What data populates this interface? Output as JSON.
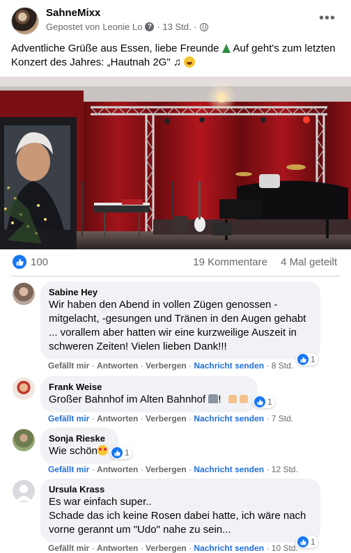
{
  "post": {
    "page_name": "SahneMixx",
    "meta_prefix": "Gepostet von",
    "author": "Leonie Lo",
    "time": "· 13 Std. ·",
    "text_line1": "Adventliche Grüße aus Essen, liebe Freunde",
    "text_line1b": "Auf geht's zum letzten",
    "text_line2": "Konzert des Jahres: „Hautnah 2G\"",
    "icons": [
      "help-icon",
      "globe-icon",
      "more-icon",
      "christmas-tree-emoji",
      "music-note-emoji",
      "grinning-face-emoji"
    ]
  },
  "stats": {
    "likes": "100",
    "comments": "19 Kommentare",
    "shares": "4 Mal geteilt"
  },
  "comment_actions": {
    "like": "Gefällt mir",
    "reply": "Antworten",
    "hide": "Verbergen",
    "message": "Nachricht senden"
  },
  "comments": [
    {
      "name": "Sabine Hey",
      "lines": [
        "Wir haben den Abend in vollen Zügen genossen -",
        "mitgelacht, -gesungen und Tränen in den Augen gehabt",
        "... vorallem aber hatten wir eine kurzweilige Auszeit in",
        "schweren Zeiten! Vielen lieben Dank!!!"
      ],
      "time": "8 Std.",
      "likes": "1"
    },
    {
      "name": "Frank Weise",
      "lines": [
        "Großer Bahnhof im Alten Bahnhof"
      ],
      "suffix": "!",
      "time": "7 Std.",
      "likes": "1"
    },
    {
      "name": "Sonja Rieske",
      "lines": [
        "Wie schön"
      ],
      "time": "12 Std.",
      "likes": "1"
    },
    {
      "name": "Ursula Krass",
      "lines": [
        "Es war einfach super..",
        "Schade das ich keine Rosen dabei hatte, ich wäre nach",
        "vorne gerannt um \"Udo\" nahe zu sein..."
      ],
      "time": "10 Std.",
      "likes": "1"
    }
  ],
  "colors": {
    "like_blue": "#1877f2",
    "link_blue": "#216fdb",
    "secondary_text": "#65676b",
    "bubble": "#f0f2f5"
  }
}
